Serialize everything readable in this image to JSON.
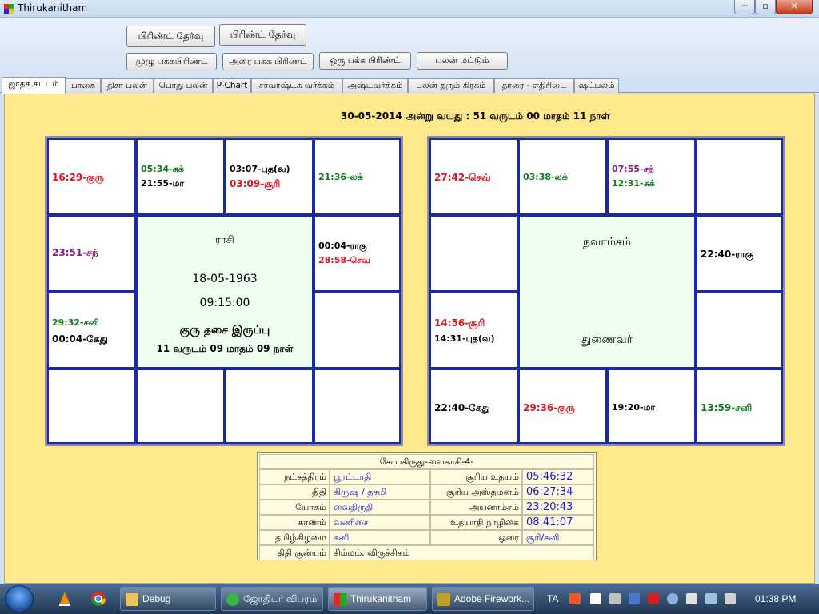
{
  "window": {
    "title": "Thirukanitham",
    "min": "─",
    "max": "▫",
    "close": "✕"
  },
  "toolbar": {
    "btn_print_select_1": "பிரிண்ட் தேர்வு",
    "btn_print_select_2": "பிரிண்ட் தேர்வு",
    "btn_full_page": "முழு பக்கபிரிண்ட்",
    "btn_half_page": "அரை பக்க பிரிண்ட்",
    "btn_one_page": "ஒரு பக்க பிரிண்ட்",
    "btn_results_only": "பலன் மட்டும்"
  },
  "tabs": [
    "ஜாதக கட்டம்",
    "பாகை",
    "திசா பலன்",
    "பொது பலன்",
    "P-Chart",
    "சர்வாஷ்டக வர்க்கம்",
    "அஷ்டவர்க்கம்",
    "பலன் தரும் கிரகம்",
    "தாரை - எதிரிடை",
    "ஷட்பலம்"
  ],
  "age_line": "30-05-2014 அன்று வயது : 51 வருடம் 00 மாதம் 11 நாள்",
  "rasi": {
    "title": "ராசி",
    "date": "18-05-1963",
    "time": "09:15:00",
    "dasa": "குரு தசை இருப்பு",
    "dasa_balance": "11 வருடம் 09 மாதம் 09 நாள்",
    "c0": [
      "16:29-குரு"
    ],
    "c1": [
      "05:34-சுக்",
      "21:55-மா"
    ],
    "c2": [
      "03:07-புத(வ)",
      "03:09-சூரி"
    ],
    "c3": [
      "21:36-லக்"
    ],
    "c4": [
      "23:51-சந்"
    ],
    "c5": [
      "00:04-ராகு",
      "28:58-செவ்"
    ],
    "c6": [
      "29:32-சனி",
      "00:04-கேது"
    ]
  },
  "navamsa": {
    "title": "நவாம்சம்",
    "subtitle": "துணைவர்",
    "c0": [
      "27:42-செவ்"
    ],
    "c1": [
      "03:38-லக்"
    ],
    "c2": [
      "07:55-சந்",
      "12:31-சுக்"
    ],
    "c3": [
      "22:40-ராகு"
    ],
    "c4": [
      "14:56-சூரி",
      "14:31-புத(வ)"
    ],
    "c5": [
      "22:40-கேது"
    ],
    "c6": [
      "29:36-குரு"
    ],
    "c7": [
      "19:20-மா"
    ],
    "c8": [
      "13:59-சனி"
    ]
  },
  "panchang": {
    "header": "சோபகிருது-வைகாசி-4-",
    "nakshatra_label": "நட்சத்திரம்",
    "nakshatra": "பூரட்டாதி",
    "sunrise_label": "சூரிய உதயம்",
    "sunrise": "05:46:32",
    "tithi_label": "திதி",
    "tithi": "கிருஷ் / தசமி",
    "sunset_label": "சூரிய அஸ்தமனம்",
    "sunset": "06:27:34",
    "yogam_label": "யோகம்",
    "yogam": "வைதிருதி",
    "ayanamsa_label": "அயனாம்சம்",
    "ayanamsa": "23:20:43",
    "karanam_label": "கரணம்",
    "karanam": "வணிசை",
    "udayadi_label": "உதயாதி நாழிகை",
    "udayadi": "08:41:07",
    "weekday_label": "தமிழ்கிழமை",
    "weekday": "சனி",
    "horai_label": "ஓரை",
    "horai": "சூரி/சனி",
    "tithi_sunya_label": "திதி சூன்யம்",
    "tithi_sunya": "சிம்மம், விருச்சிகம்"
  },
  "taskbar": {
    "items": [
      "Debug",
      "ஜோதிடர் விபரம்",
      "Thirukanitham",
      "Adobe Firework..."
    ],
    "lang": "TA",
    "clock": "01:38 PM"
  },
  "colors": {
    "panel": "#ffe98c",
    "grid": "#1a2aa0",
    "center": "#efffef"
  }
}
